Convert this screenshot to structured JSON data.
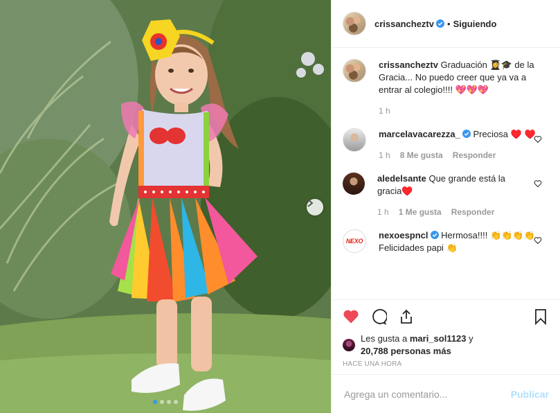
{
  "post": {
    "author": "crissancheztv",
    "follow_status": "Siguiendo",
    "separator": "•",
    "more_icon": "more-dots-icon",
    "carousel_dots": 4,
    "carousel_active": 0
  },
  "caption": {
    "username": "crissancheztv",
    "text": "Graduación 👩‍🎓🎓 de la Gracia... No puedo creer que ya va a entrar al colegio!!!! 💖💖💖",
    "age": "1 h"
  },
  "comments": [
    {
      "username": "marcelavacarezza_",
      "verified": true,
      "text": "Preciosa ♥️ ♥️",
      "age": "1 h",
      "likes": "8 Me gusta",
      "reply": "Responder"
    },
    {
      "username": "aledelsante",
      "verified": false,
      "text": "Que grande está la gracia♥️",
      "age": "1 h",
      "likes": "1 Me gusta",
      "reply": "Responder"
    },
    {
      "username": "nexoespncl",
      "verified": true,
      "text": "Hermosa!!!! 👏👏👏👏 Felicidades papi 👏",
      "age": "",
      "likes": "",
      "reply": ""
    }
  ],
  "likes": {
    "prefix": "Les gusta a",
    "user": "mari_sol1123",
    "joiner": "y",
    "others": "20,788 personas más"
  },
  "timestamp": "HACE UNA HORA",
  "add_comment": {
    "placeholder": "Agrega un comentario...",
    "publish_label": "Publicar"
  },
  "colors": {
    "accent": "#3897f0",
    "like_red": "#ed4956",
    "publish_disabled": "#b2dffc",
    "muted": "#999999"
  }
}
